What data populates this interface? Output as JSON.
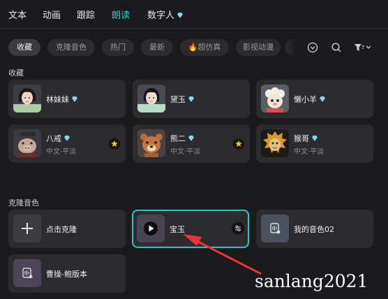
{
  "tabs": [
    {
      "label": "文本",
      "active": false
    },
    {
      "label": "动画",
      "active": false
    },
    {
      "label": "跟踪",
      "active": false
    },
    {
      "label": "朗读",
      "active": true
    },
    {
      "label": "数字人",
      "active": false
    }
  ],
  "filters": [
    {
      "label": "收藏",
      "active": true
    },
    {
      "label": "克隆音色",
      "active": false
    },
    {
      "label": "热门",
      "active": false
    },
    {
      "label": "最新",
      "active": false
    },
    {
      "label": "🔥超仿真",
      "active": false
    },
    {
      "label": "影视动漫",
      "active": false
    }
  ],
  "toolbar_icons": [
    "chevron-down-circle-icon",
    "search-icon",
    "filter-icon"
  ],
  "favorites": {
    "title": "收藏",
    "voices": [
      {
        "name": "林妹妹",
        "subtitle": "",
        "vip": true,
        "starred": false,
        "icon": "avatar-lin-meimei"
      },
      {
        "name": "黛玉",
        "subtitle": "",
        "vip": true,
        "starred": false,
        "icon": "avatar-daiyu"
      },
      {
        "name": "懒小羊",
        "subtitle": "",
        "vip": true,
        "starred": false,
        "icon": "avatar-lan-xiaoyang"
      },
      {
        "name": "八戒",
        "subtitle": "中文·平淡",
        "vip": true,
        "starred": true,
        "icon": "avatar-bajie"
      },
      {
        "name": "熊二",
        "subtitle": "中文·平淡",
        "vip": true,
        "starred": true,
        "icon": "avatar-xiong-er"
      },
      {
        "name": "猴哥",
        "subtitle": "中文·平淡",
        "vip": true,
        "starred": false,
        "icon": "avatar-houge"
      }
    ]
  },
  "cloned": {
    "title": "克隆音色",
    "clone_button_label": "点击克隆",
    "items": [
      {
        "name": "宝玉",
        "selected": true
      },
      {
        "name": "我的音色02",
        "selected": false
      },
      {
        "name": "曹操-鲍版本",
        "selected": false
      }
    ]
  },
  "watermark": "sanlang2021",
  "colors": {
    "accent": "#26d0d8",
    "background": "#1b1b1d",
    "card": "#2c2c2f",
    "arrow": "#e8343a",
    "star": "#f2c230"
  }
}
